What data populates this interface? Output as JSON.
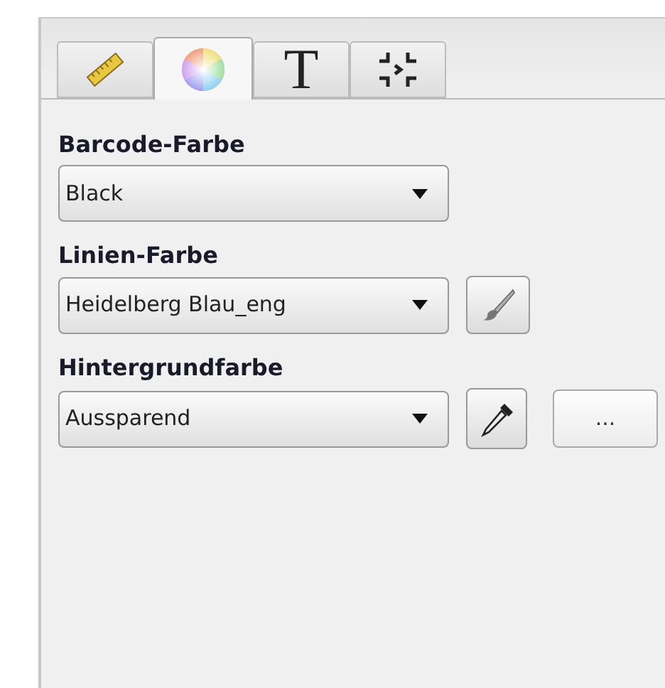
{
  "tabs": [
    {
      "kind": "ruler",
      "selected": false
    },
    {
      "kind": "color",
      "selected": true
    },
    {
      "kind": "text",
      "label": "T",
      "selected": false
    },
    {
      "kind": "compress",
      "selected": false
    }
  ],
  "fields": [
    {
      "label": "Barcode-Farbe",
      "value": "Black"
    },
    {
      "label": "Linien-Farbe",
      "value": "Heidelberg Blau_eng",
      "buttons": [
        {
          "kind": "brush"
        }
      ]
    },
    {
      "label": "Hintergrundfarbe",
      "value": "Aussparend",
      "buttons": [
        {
          "kind": "eyedropper"
        },
        {
          "kind": "text",
          "label": "..."
        }
      ]
    }
  ]
}
